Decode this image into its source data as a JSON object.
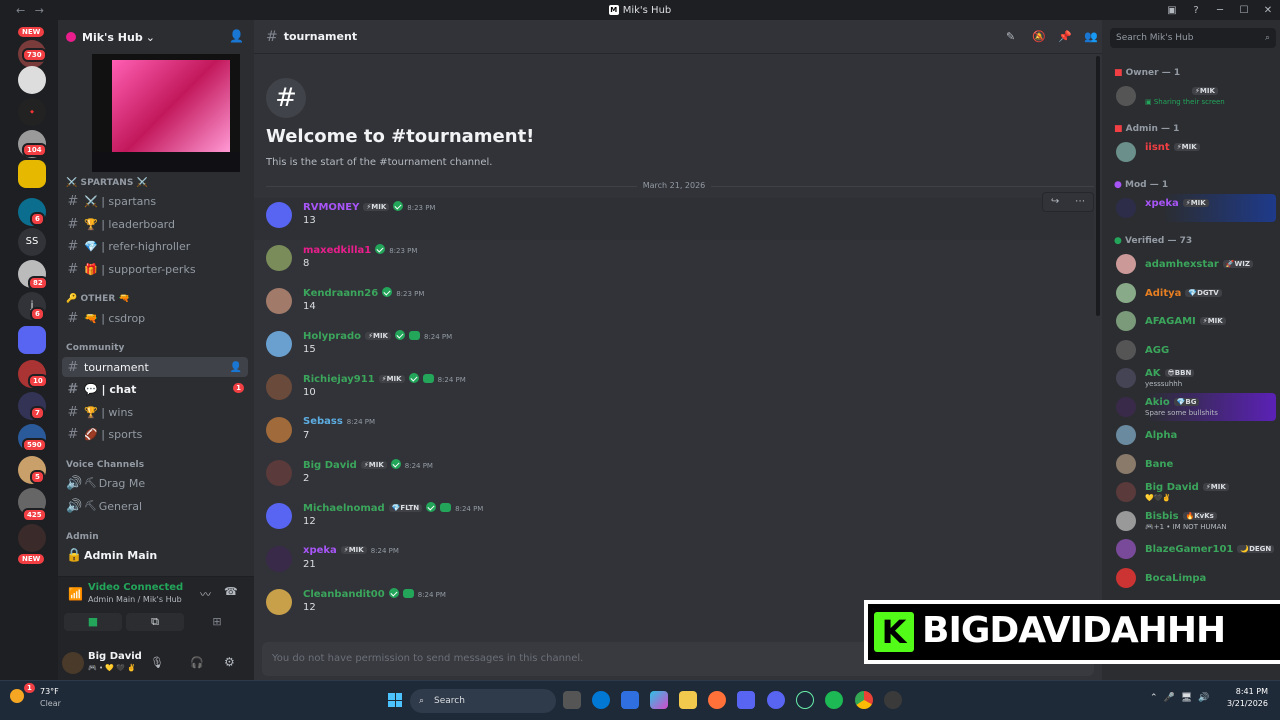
{
  "window": {
    "title": "Mik's Hub",
    "back": "←",
    "forward": "→",
    "minimize": "─",
    "maximize": "☐",
    "close": "✕"
  },
  "guilds": {
    "badges": [
      "730",
      "104",
      "6",
      "82",
      "6",
      "10",
      "7",
      "590",
      "5",
      "425"
    ],
    "new_label": "NEW",
    "text_icons": [
      "SS",
      "j"
    ]
  },
  "server": {
    "name": "Mik's Hub",
    "chevron": "⌄"
  },
  "stream_preview_visible": true,
  "categories": {
    "spartans": "⚔️ SPARTANS ⚔️",
    "other": "🔑 OTHER 🔫",
    "community": "Community",
    "voice": "Voice Channels",
    "admin": "Admin"
  },
  "channels": {
    "spartans": [
      "⚔️ | spartans",
      "🏆 | leaderboard",
      "💎 | refer-highroller",
      "🎁 | supporter-perks"
    ],
    "other": [
      "🔫 | csdrop"
    ],
    "community": {
      "tournament": "tournament",
      "chat": "💬 | chat",
      "chat_unread": "1",
      "wins": "🏆 | wins",
      "sports": "🏈 | sports"
    },
    "voice": [
      "Drag Me",
      "General"
    ],
    "admin": "Admin Main"
  },
  "voice_status": {
    "title": "Video Connected",
    "subtitle": "Admin Main / Mik's Hub"
  },
  "user": {
    "name": "Big David",
    "status": "🎮 • 💛 🖤 ✌️"
  },
  "channel_header": {
    "name": "tournament",
    "search_placeholder": "Search Mik's Hub"
  },
  "welcome": {
    "title": "Welcome to #tournament!",
    "subtitle": "This is the start of the #tournament channel.",
    "date_divider": "March 21, 2026"
  },
  "messages": [
    {
      "user": "RVMONEY",
      "color": "#a855f7",
      "tag": "⚡MIK",
      "verified": true,
      "pad": false,
      "time": "8:23 PM",
      "text": "13"
    },
    {
      "user": "maxedkilla1",
      "color": "#e91e8c",
      "tag": "",
      "verified": true,
      "pad": false,
      "time": "8:23 PM",
      "text": "8"
    },
    {
      "user": "Kendraann26",
      "color": "#3ba55c",
      "tag": "",
      "verified": true,
      "pad": false,
      "time": "8:23 PM",
      "text": "14"
    },
    {
      "user": "Holyprado",
      "color": "#3ba55c",
      "tag": "⚡MIK",
      "verified": true,
      "pad": true,
      "time": "8:24 PM",
      "text": "15"
    },
    {
      "user": "Richiejay911",
      "color": "#3ba55c",
      "tag": "⚡MIK",
      "verified": true,
      "pad": true,
      "time": "8:24 PM",
      "text": "10"
    },
    {
      "user": "Sebass",
      "color": "#5dade2",
      "tag": "",
      "verified": false,
      "pad": false,
      "time": "8:24 PM",
      "text": "7"
    },
    {
      "user": "Big David",
      "color": "#3ba55c",
      "tag": "⚡MIK",
      "verified": true,
      "pad": false,
      "time": "8:24 PM",
      "text": "2"
    },
    {
      "user": "Michaelnomad",
      "color": "#3ba55c",
      "tag": "💎FLTN",
      "verified": true,
      "pad": true,
      "time": "8:24 PM",
      "text": "12"
    },
    {
      "user": "xpeka",
      "color": "#a855f7",
      "tag": "⚡MIK",
      "verified": false,
      "pad": false,
      "time": "8:24 PM",
      "text": "21"
    },
    {
      "user": "Cleanbandit00",
      "color": "#3ba55c",
      "tag": "",
      "verified": true,
      "pad": true,
      "time": "8:24 PM",
      "text": "12"
    }
  ],
  "composer": {
    "placeholder": "You do not have permission to send messages in this channel."
  },
  "members": {
    "groups": {
      "owner": "Owner — 1",
      "admin": "Admin — 1",
      "mod": "Mod — 1",
      "verified": "Verified — 73"
    },
    "owner": {
      "name": "",
      "tag": "⚡MIK",
      "status": "Sharing their screen"
    },
    "admin": {
      "name": "iisnt",
      "tag": "⚡MIK"
    },
    "mod": {
      "name": "xpeka",
      "tag": "⚡MIK"
    },
    "verified": [
      {
        "name": "adamhexstar",
        "tag": "🚀WIZ",
        "status": "",
        "color": "#3ba55c"
      },
      {
        "name": "Aditya",
        "tag": "💎DGTV",
        "status": "",
        "color": "#e67e22"
      },
      {
        "name": "AFAGAMI",
        "tag": "⚡MIK",
        "status": "",
        "color": "#3ba55c"
      },
      {
        "name": "AGG",
        "tag": "",
        "status": "",
        "color": "#3ba55c"
      },
      {
        "name": "AK",
        "tag": "😎BBN",
        "status": "yesssuhhh",
        "color": "#3ba55c"
      },
      {
        "name": "Akio",
        "tag": "💎BG",
        "status": "Spare some bullshits",
        "color": "#3ba55c"
      },
      {
        "name": "Alpha",
        "tag": "",
        "status": "",
        "color": "#3ba55c"
      },
      {
        "name": "Bane",
        "tag": "",
        "status": "",
        "color": "#3ba55c"
      },
      {
        "name": "Big David",
        "tag": "⚡MIK",
        "status": "💛🖤✌️",
        "color": "#3ba55c"
      },
      {
        "name": "Bisbis",
        "tag": "🔥KvKs",
        "status": "🎮+1 • IM NOT HUMAN",
        "color": "#3ba55c"
      },
      {
        "name": "BlazeGamer101",
        "tag": "🌙DEGN",
        "status": "",
        "color": "#3ba55c"
      },
      {
        "name": "BocaLimpa",
        "tag": "",
        "status": "",
        "color": "#3ba55c"
      }
    ]
  },
  "overlay": {
    "text": "BIGDAVIDAHHH",
    "logo": "K"
  },
  "taskbar": {
    "weather_temp": "73°F",
    "weather_desc": "Clear",
    "search_label": "Search",
    "time": "8:41 PM",
    "date": "3/21/2026",
    "weather_badge": "1"
  },
  "colors": {
    "accent": "#5865f2",
    "online": "#23a55a",
    "danger": "#f23f43",
    "kick": "#53fc18"
  }
}
